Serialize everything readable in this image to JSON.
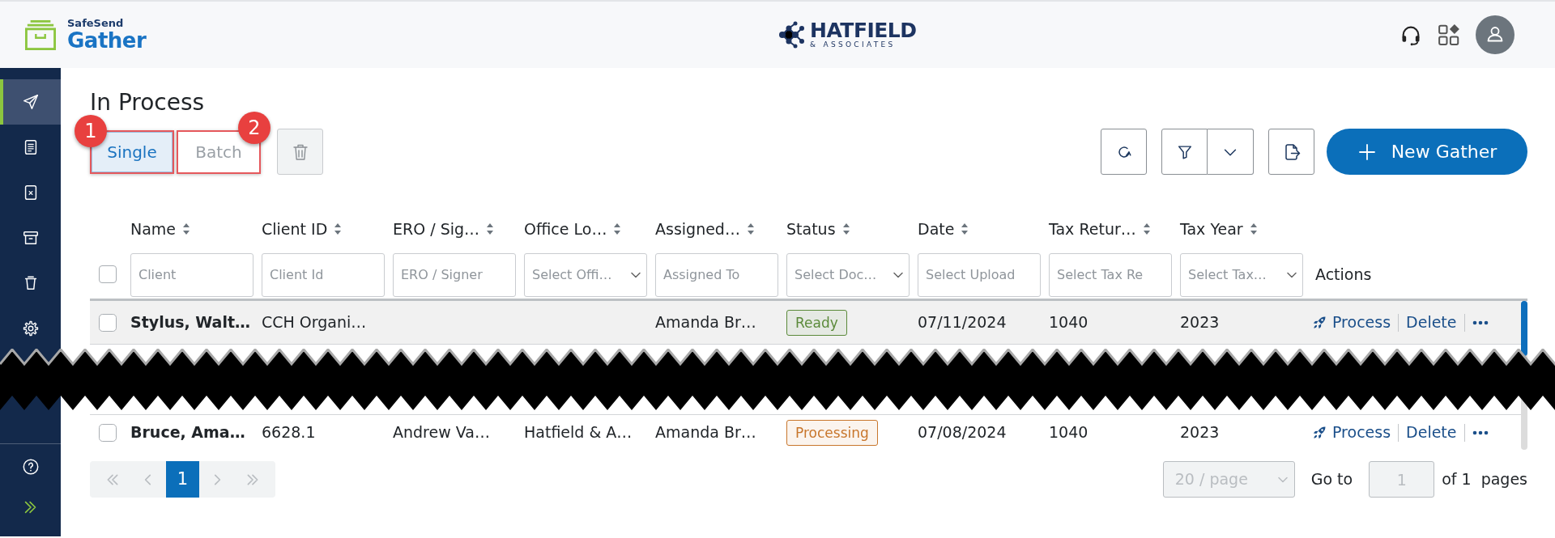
{
  "header": {
    "logo": {
      "brand": "SafeSend",
      "product": "Gather"
    },
    "firm_logo": {
      "name": "HATFIELD",
      "tagline": "& ASSOCIATES"
    }
  },
  "sidebar": {
    "items": [
      {
        "kind": "send",
        "selected": true
      },
      {
        "kind": "document",
        "selected": false
      },
      {
        "kind": "rejected",
        "selected": false
      },
      {
        "kind": "archive",
        "selected": false
      },
      {
        "kind": "trash",
        "selected": false
      },
      {
        "kind": "settings",
        "selected": false
      }
    ],
    "footer_items": [
      {
        "kind": "help",
        "selected": false
      },
      {
        "kind": "expand",
        "selected": false
      }
    ]
  },
  "page": {
    "title": "In Process"
  },
  "tabs": [
    {
      "label": "Single",
      "selected": true,
      "callout": "1"
    },
    {
      "label": "Batch",
      "selected": false,
      "callout": "2"
    }
  ],
  "toolbar": {
    "delete_disabled": true,
    "new_button": "New Gather"
  },
  "table": {
    "select_all_checked": false,
    "columns": [
      {
        "label": "Name",
        "filter": {
          "kind": "input",
          "placeholder": "Client"
        }
      },
      {
        "label": "Client ID",
        "filter": {
          "kind": "input",
          "placeholder": "Client Id"
        }
      },
      {
        "label": "ERO / Sig…",
        "filter": {
          "kind": "input",
          "placeholder": "ERO / Signer"
        }
      },
      {
        "label": "Office Lo…",
        "filter": {
          "kind": "select",
          "placeholder": "Select Offi…"
        }
      },
      {
        "label": "Assigned…",
        "filter": {
          "kind": "input",
          "placeholder": "Assigned To"
        }
      },
      {
        "label": "Status",
        "filter": {
          "kind": "select",
          "placeholder": "Select Doc…"
        }
      },
      {
        "label": "Date",
        "filter": {
          "kind": "input",
          "placeholder": "Select Upload"
        }
      },
      {
        "label": "Tax Retur…",
        "filter": {
          "kind": "input",
          "placeholder": "Select Tax Re"
        }
      },
      {
        "label": "Tax Year",
        "filter": {
          "kind": "select",
          "placeholder": "Select Tax…"
        }
      }
    ],
    "actions_label": "Actions",
    "rows": [
      {
        "kind": "record",
        "highlighted": true,
        "checked": false,
        "name": "Stylus, Walt…",
        "client_id": "CCH Organi…",
        "assigned_to": "Amanda Br…",
        "status": {
          "label": "Ready",
          "color": "#5b8a3a"
        },
        "date": "07/11/2024",
        "tax_return": "1040",
        "tax_year": "2023",
        "actions": [
          {
            "kind": "process",
            "label": "Process"
          },
          {
            "kind": "delete",
            "label": "Delete"
          }
        ]
      },
      {
        "kind": "break"
      },
      {
        "kind": "record",
        "highlighted": false,
        "checked": false,
        "name": "Bruce, Ama…",
        "client_id": "6628.1",
        "ero_signer": "Andrew Va…",
        "office_location": "Hatfield & A…",
        "assigned_to": "Amanda Br…",
        "status": {
          "label": "Processing",
          "color": "#c8762c"
        },
        "date": "07/08/2024",
        "tax_return": "1040",
        "tax_year": "2023",
        "actions": [
          {
            "kind": "process",
            "label": "Process"
          },
          {
            "kind": "delete",
            "label": "Delete"
          }
        ]
      }
    ]
  },
  "pagination": {
    "nav_disabled": true,
    "pages": [
      {
        "label": "1",
        "selected": true
      }
    ],
    "page_size": {
      "value": "20 / page",
      "disabled": true
    },
    "goto": {
      "label": "Go to",
      "value": "1",
      "disabled": true
    },
    "total": "of 1",
    "unit": "pages"
  }
}
